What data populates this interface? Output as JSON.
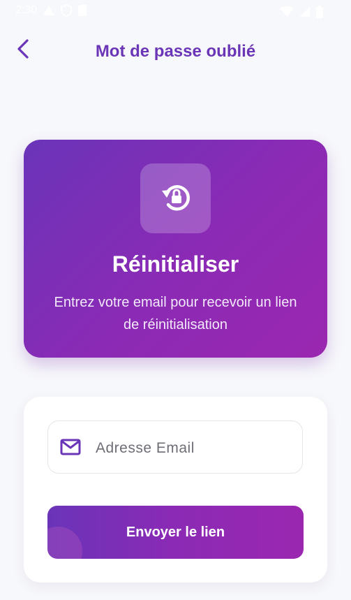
{
  "status_bar": {
    "time": "2:30"
  },
  "header": {
    "back_icon": "chevron-left-icon",
    "title": "Mot de passe oublié"
  },
  "hero": {
    "icon": "lock-reset-icon",
    "title": "Réinitialiser",
    "subtitle": "Entrez votre email pour recevoir un lien de réinitialisation"
  },
  "form": {
    "email": {
      "icon": "mail-icon",
      "placeholder": "Adresse Email",
      "value": ""
    },
    "submit_label": "Envoyer le lien"
  },
  "colors": {
    "accent": "#6a35b6",
    "gradient_start": "#6a34b8",
    "gradient_end": "#9b27b0",
    "background": "#f7f8fb"
  }
}
